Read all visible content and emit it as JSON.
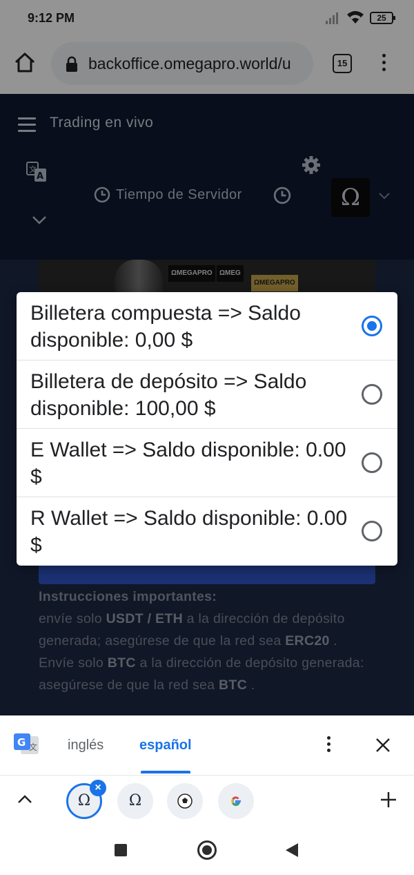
{
  "status_bar": {
    "time": "9:12 PM",
    "battery": "25"
  },
  "browser": {
    "url": "backoffice.omegapro.world/u",
    "tab_count": "15"
  },
  "header": {
    "title": "Trading en vivo",
    "server_time_label": "Tiempo de Servidor",
    "avatar_glyph": "Ω"
  },
  "banner": {
    "logo_1": "ΩMEGAPRO",
    "logo_2": "ΩMEG",
    "logo_3": "ΩMEGAPRO"
  },
  "instructions": {
    "title": "Instrucciones importantes:",
    "line1_pre": "envíe solo ",
    "line1_bold": "USDT / ETH",
    "line1_post": " a la dirección de depósito generada; asegúrese de que la red sea ",
    "line1_network": "ERC20",
    "line1_end": " .",
    "line2_pre": "Envíe solo ",
    "line2_bold": "BTC",
    "line2_post": " a la dirección de depósito generada: asegúrese de que la red sea ",
    "line2_network": "BTC",
    "line2_end": " ."
  },
  "wallet_dialog": {
    "options": [
      {
        "label": "Billetera compuesta => Saldo disponible: 0,00 $",
        "selected": true
      },
      {
        "label": "Billetera de depósito => Saldo disponible: 100,00 $",
        "selected": false
      },
      {
        "label": "E Wallet => Saldo disponible: 0.00 $",
        "selected": false
      },
      {
        "label": "R Wallet => Saldo disponible: 0.00 $",
        "selected": false
      }
    ]
  },
  "translate_bar": {
    "source_lang": "inglés",
    "target_lang": "español"
  },
  "tab_strip": {
    "tab1": "Ω",
    "tab2": "Ω",
    "close_glyph": "×"
  },
  "colors": {
    "accent": "#1a73e8",
    "header_bg": "#0f1930",
    "page_bg": "#1c2944"
  }
}
